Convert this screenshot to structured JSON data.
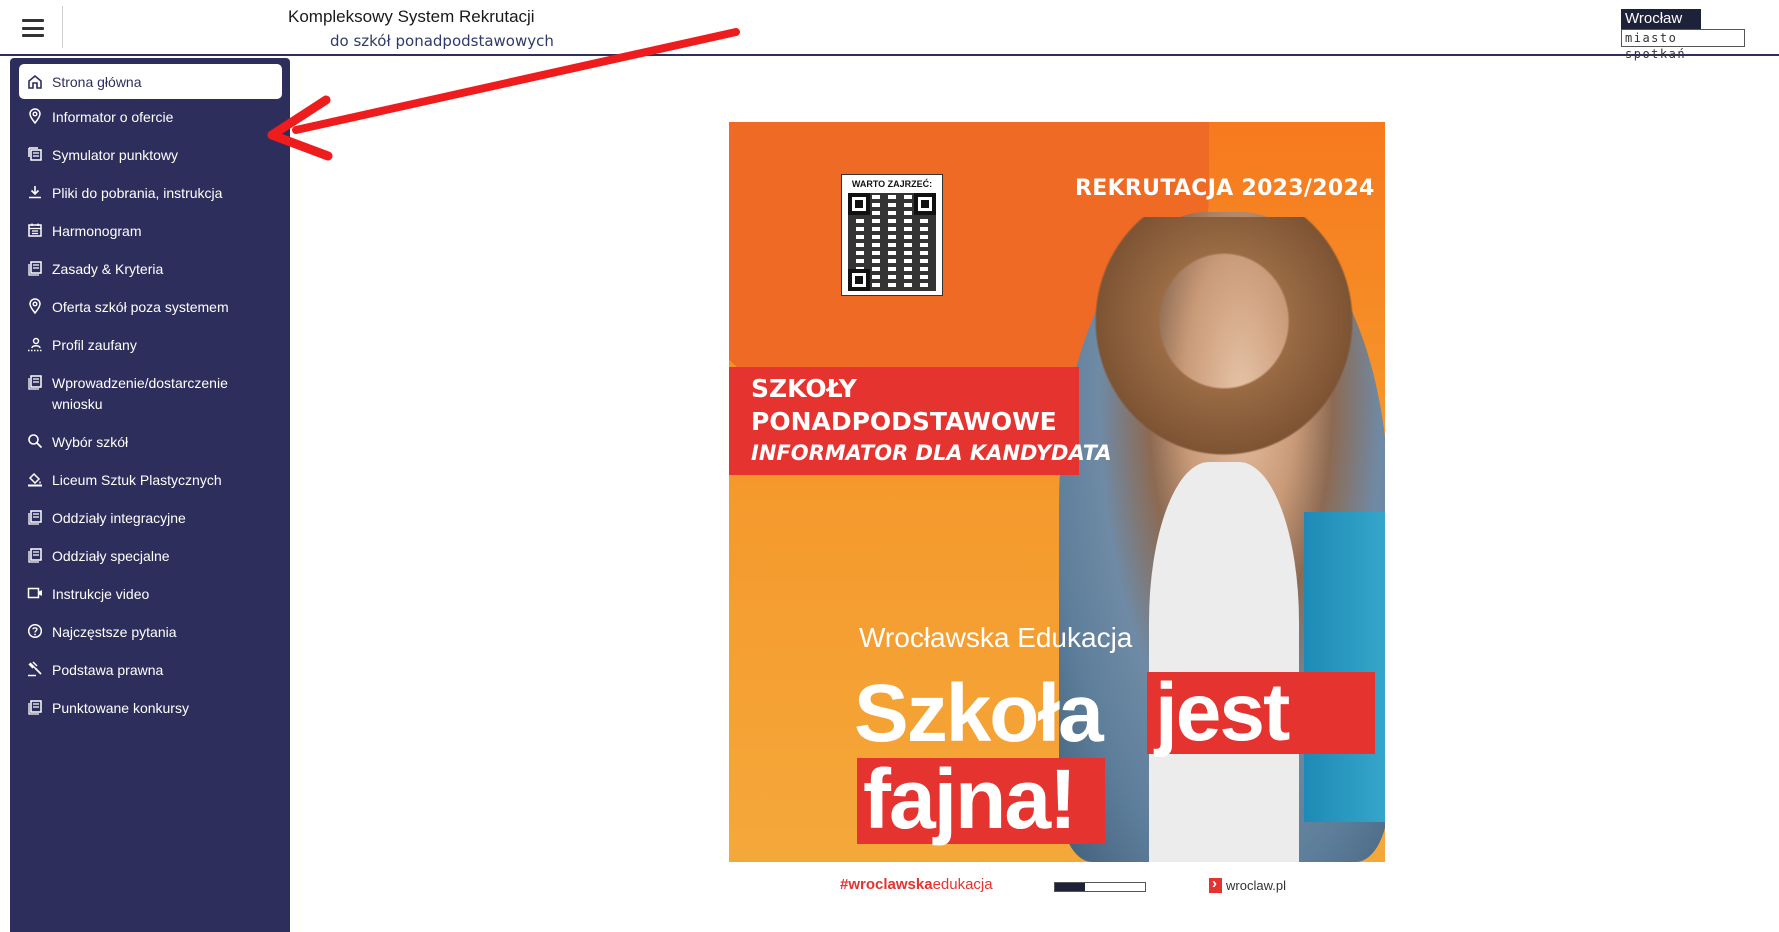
{
  "header": {
    "title": "Kompleksowy System Rekrutacji",
    "subtitle": "do szkół ponadpodstawowych",
    "logo_top": "Wrocław",
    "logo_bottom": "miasto spotkań"
  },
  "sidebar": {
    "items": [
      {
        "label": "Strona główna",
        "icon": "home-icon"
      },
      {
        "label": "Informator o ofercie",
        "icon": "location-pin-icon"
      },
      {
        "label": "Symulator punktowy",
        "icon": "calculator-icon"
      },
      {
        "label": "Pliki do pobrania, instrukcja",
        "icon": "download-icon"
      },
      {
        "label": "Harmonogram",
        "icon": "calendar-icon"
      },
      {
        "label": "Zasady & Kryteria",
        "icon": "document-stack-icon"
      },
      {
        "label": "Oferta szkół poza systemem",
        "icon": "location-pin-icon"
      },
      {
        "label": "Profil zaufany",
        "icon": "user-dotted-icon"
      },
      {
        "label": "Wprowadzenie/dostarczenie wniosku",
        "icon": "document-stack-icon"
      },
      {
        "label": "Wybór szkół",
        "icon": "search-icon"
      },
      {
        "label": "Liceum Sztuk Plastycznych",
        "icon": "paint-bucket-icon"
      },
      {
        "label": "Oddziały integracyjne",
        "icon": "document-stack-icon"
      },
      {
        "label": "Oddziały specjalne",
        "icon": "document-stack-icon"
      },
      {
        "label": "Instrukcje video",
        "icon": "video-icon"
      },
      {
        "label": "Najczęstsze pytania",
        "icon": "help-icon"
      },
      {
        "label": "Podstawa prawna",
        "icon": "gavel-icon"
      },
      {
        "label": "Punktowane konkursy",
        "icon": "document-stack-icon"
      }
    ]
  },
  "poster": {
    "qr_label": "WARTO ZAJRZEĆ:",
    "recruitment": "REKRUTACJA 2023/2024",
    "line1": "SZKOŁY",
    "line2": "PONADPODSTAWOWE",
    "line3": "INFORMATOR DLA KANDYDATA",
    "edu_a": "Wrocławska",
    "edu_b": "Edukacja",
    "slogan_1": "Szkoła",
    "slogan_2": "jest",
    "slogan_3": "fajna!"
  },
  "footer": {
    "hashtag_bold": "#wroclawska",
    "hashtag_rest": "edukacja",
    "site": "wroclaw.pl"
  },
  "colors": {
    "sidebar_bg": "#2e2e5c",
    "accent_red": "#e5332f",
    "poster_orange": "#f59a1e"
  }
}
